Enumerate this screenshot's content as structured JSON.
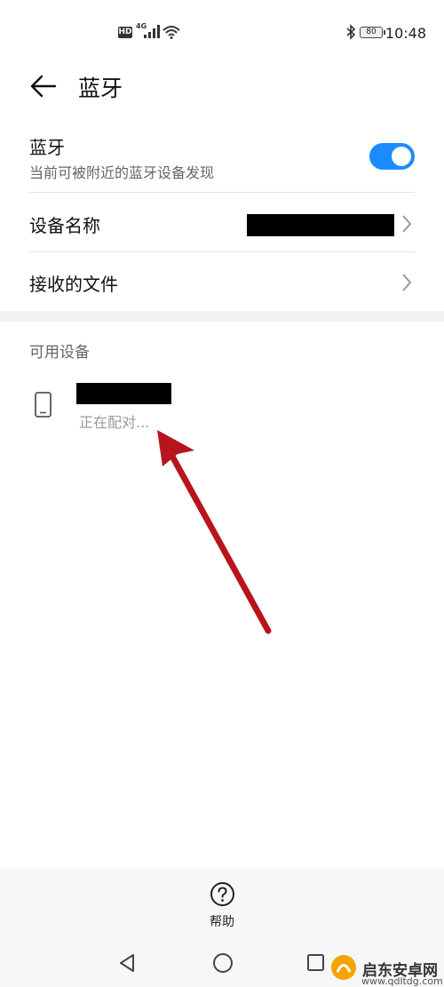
{
  "status_bar": {
    "hd": "HD",
    "network": "4G",
    "battery": "80",
    "time": "10:48"
  },
  "header": {
    "title": "蓝牙"
  },
  "bluetooth_row": {
    "title": "蓝牙",
    "subtitle": "当前可被附近的蓝牙设备发现",
    "enabled": true,
    "accent_color": "#1a8cff"
  },
  "device_name_row": {
    "label": "设备名称"
  },
  "received_files_row": {
    "label": "接收的文件"
  },
  "available_devices": {
    "section_label": "可用设备",
    "items": [
      {
        "status": "正在配对..."
      }
    ]
  },
  "bottom": {
    "help_label": "帮助"
  },
  "watermark": {
    "brand": "启东安卓网",
    "url": "www.qdltdg.com"
  },
  "annotation_color": "#b8141c"
}
